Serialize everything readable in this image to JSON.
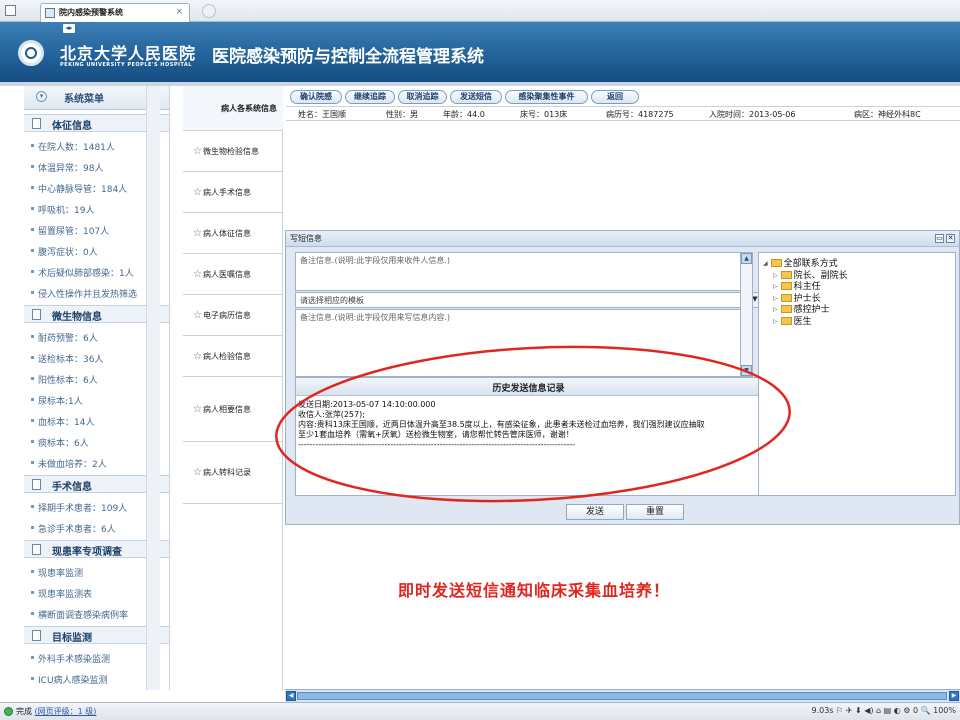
{
  "browser": {
    "tab_title": "院内感染预警系统",
    "tab_close": "×"
  },
  "header": {
    "hospital_name": "北京大学人民医院",
    "hospital_en": "PEKING UNIVERSITY PEOPLE'S HOSPITAL",
    "system_title": "医院感染预防与控制全流程管理系统"
  },
  "sidebar": {
    "title": "系统菜单",
    "sections": [
      {
        "title": "体征信息",
        "items": [
          "在院人数：1481人",
          "体温异常：98人",
          "中心静脉导管：184人",
          "呼吸机：19人",
          "留置尿管：107人",
          "腹泻症状：0人",
          "术后疑似肺部感染：1人",
          "侵入性操作并且发热筛选"
        ]
      },
      {
        "title": "微生物信息",
        "items": [
          "耐药预警：6人",
          "送检标本：36人",
          "阳性标本：6人",
          "尿标本:1人",
          "血标本：14人",
          "痰标本：6人",
          "未做血培养：2人"
        ]
      },
      {
        "title": "手术信息",
        "items": [
          "择期手术患者：109人",
          "急诊手术患者：6人"
        ]
      },
      {
        "title": "现患率专项调查",
        "items": [
          "现患率监测",
          "现患率监测表",
          "横断面调查感染病例率"
        ]
      },
      {
        "title": "目标监测",
        "items": [
          "外科手术感染监测",
          "ICU病人感染监测"
        ]
      }
    ]
  },
  "tabs": [
    "病人各系统信息",
    "微生物检验信息",
    "病人手术信息",
    "病人体征信息",
    "病人医嘱信息",
    "电子病历信息",
    "病人检验信息",
    "病人相要信息",
    "病人转科记录"
  ],
  "toolbar": [
    "确认院感",
    "继续追踪",
    "取消追踪",
    "发送短信",
    "感染聚集性事件",
    "返回"
  ],
  "patient": {
    "name": "姓名：王国顺",
    "sex": "性别：男",
    "age": "年龄：44.0",
    "bed": "床号：013床",
    "record": "病历号：4187275",
    "admit": "入院时间：2013-05-06",
    "ward": "病区：神经外科8C"
  },
  "dialog": {
    "title": "写短信息",
    "notes_placeholder": "备注信息.(说明:此字段仅用来收件人信息.)",
    "template_placeholder": "请选择相应的模板",
    "content_placeholder": "备注信息.(说明:此字段仅用来写信息内容.)",
    "history_title": "历史发送信息记录",
    "history_lines": [
      "发送日期:2013-05-07 14:10:00.000",
      "收信人:张萍(257);",
      "内容:贵科13床王国顺，近两日体温升高至38.5度以上，有感染征象，此患者未送检过血培养，我们强烈建议应抽取",
      "至少1套血培养（需氧+厌氧）送检微生物室，请您帮忙转告管床医师，谢谢！",
      "------------------------------------------------------------------------------------------------"
    ],
    "tree": [
      "全部联系方式",
      "院长、副院长",
      "科主任",
      "护士长",
      "感控护士",
      "医生"
    ],
    "send_label": "发送",
    "reset_label": "重置"
  },
  "notice": "即时发送短信通知临床采集血培养！",
  "statusbar": {
    "done": "完成",
    "rating": "(网页评级：1 级)",
    "right": "9.03s  ⚐  ✈  ⬇  ◀)  ⌂  ▤  ◐  ⚙ 0  🔍 100%"
  },
  "colors": {
    "header_blue": "#1d5b93",
    "annotation_red": "#e0261f"
  }
}
